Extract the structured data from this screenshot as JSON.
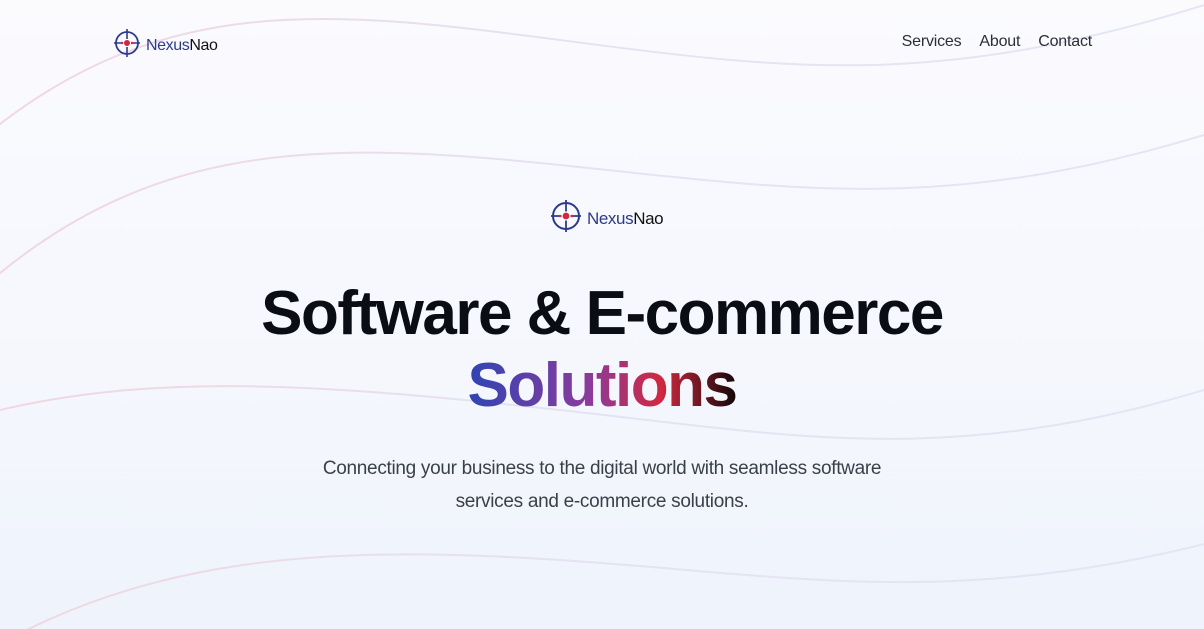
{
  "header": {
    "brand": {
      "part1": "Nexus",
      "part2": "Nao",
      "icon": "crosshair-logo-icon"
    },
    "nav": [
      {
        "label": "Services"
      },
      {
        "label": "About"
      },
      {
        "label": "Contact"
      }
    ]
  },
  "hero": {
    "brand": {
      "part1": "Nexus",
      "part2": "Nao",
      "icon": "crosshair-logo-icon"
    },
    "title_line1": "Software & E-commerce",
    "title_line2": "Solutions",
    "subtitle": "Connecting your business to the digital world with seamless software services and e-commerce solutions."
  },
  "colors": {
    "brand_blue": "#2d3a8c",
    "accent_red": "#d1283f",
    "gradient_start": "#2f45b3",
    "gradient_mid": "#8a3b9c",
    "background": "#f5f7fd"
  }
}
